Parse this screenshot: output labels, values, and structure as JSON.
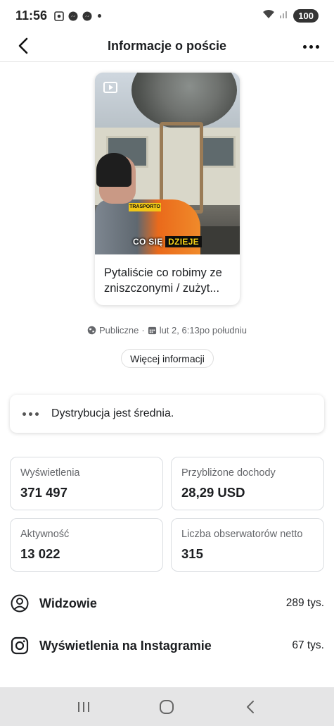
{
  "status_bar": {
    "time": "11:56",
    "battery": "100"
  },
  "header": {
    "title": "Informacje o poście"
  },
  "post": {
    "video_caption_prefix": "CO SIĘ",
    "video_caption_highlight": "DZIEJE",
    "video_sign_text": "TRASPORTO",
    "text": "Pytaliście co robimy ze zniszczonymi / zużyt..."
  },
  "meta": {
    "visibility": "Publiczne",
    "separator": "·",
    "date": "lut 2, 6:13po południu"
  },
  "more_info_button": "Więcej informacji",
  "distribution": {
    "text": "Dystrybucja jest średnia."
  },
  "stats": [
    {
      "label": "Wyświetlenia",
      "value": "371 497"
    },
    {
      "label": "Przybliżone dochody",
      "value": "28,29 USD"
    },
    {
      "label": "Aktywność",
      "value": "13 022"
    },
    {
      "label": "Liczba obserwatorów netto",
      "value": "315"
    }
  ],
  "rows": [
    {
      "label": "Widzowie",
      "value": "289 tys.",
      "icon": "person-circle-icon"
    },
    {
      "label": "Wyświetlenia na Instagramie",
      "value": "67 tys.",
      "icon": "instagram-icon"
    }
  ],
  "colors": {
    "secondary_text": "#65676b",
    "primary_text": "#1c1e21",
    "nav_bar_bg": "#e5e5e6",
    "caption_highlight": "#f6d21b"
  }
}
